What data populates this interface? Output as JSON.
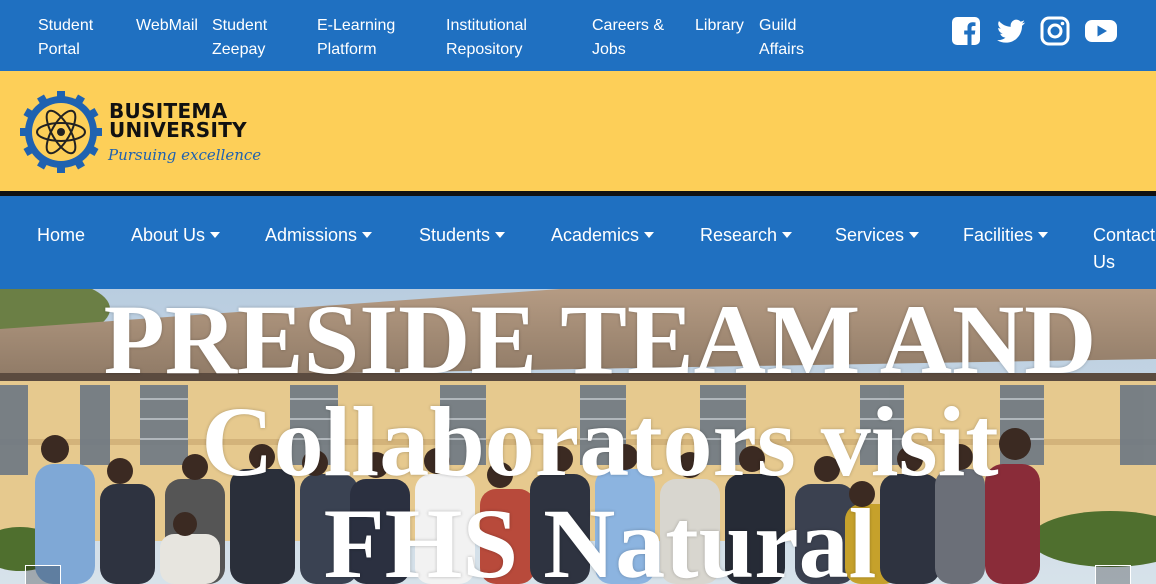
{
  "top_links": [
    {
      "id": "student-portal",
      "label": "Student\nPortal"
    },
    {
      "id": "webmail",
      "label": "WebMail"
    },
    {
      "id": "student-zeepay",
      "label": "Student\nZeepay"
    },
    {
      "id": "elearning",
      "label": "E-Learning\nPlatform"
    },
    {
      "id": "repository",
      "label": "Institutional\nRepository"
    },
    {
      "id": "careers",
      "label": "Careers &\nJobs"
    },
    {
      "id": "library",
      "label": "Library"
    },
    {
      "id": "guild",
      "label": "Guild\nAffairs"
    }
  ],
  "social": [
    "facebook-icon",
    "twitter-icon",
    "instagram-icon",
    "youtube-icon"
  ],
  "brand": {
    "name": "BUSITEMA\nUNIVERSITY",
    "tagline": "Pursuing excellence"
  },
  "nav": [
    {
      "label": "Home",
      "dropdown": false
    },
    {
      "label": "About Us",
      "dropdown": true
    },
    {
      "label": "Admissions",
      "dropdown": true
    },
    {
      "label": "Students",
      "dropdown": true
    },
    {
      "label": "Academics",
      "dropdown": true
    },
    {
      "label": "Research",
      "dropdown": true
    },
    {
      "label": "Services",
      "dropdown": true
    },
    {
      "label": "Facilities",
      "dropdown": true
    },
    {
      "label": "Contact\nUs",
      "dropdown": false
    }
  ],
  "hero": {
    "title": "PRESIDE TEAM AND Collaborators visit FHS Natural"
  },
  "colors": {
    "primary_blue": "#1f70c1",
    "brand_yellow": "#fdcf58",
    "rule_black": "#111111"
  }
}
